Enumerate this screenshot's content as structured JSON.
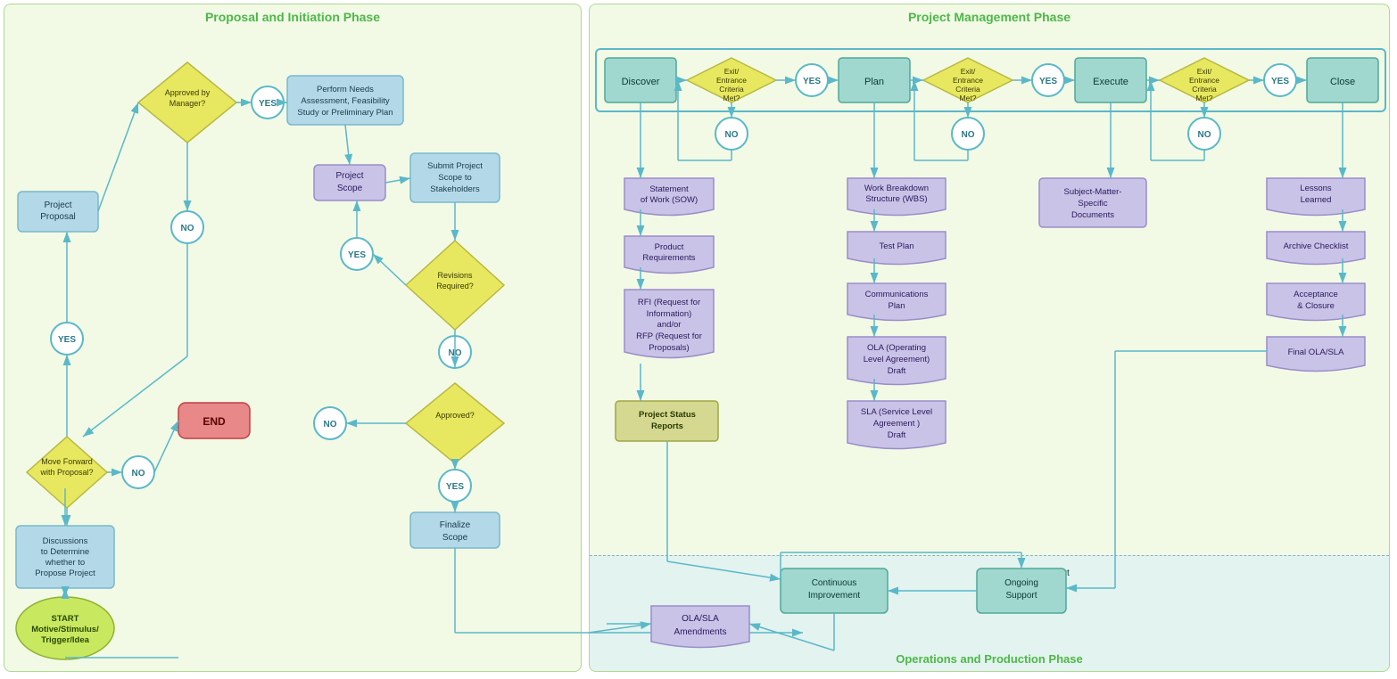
{
  "diagram": {
    "left_title": "Proposal and Initiation Phase",
    "right_title": "Project Management Phase",
    "ops_title": "Operations and Production Phase",
    "nodes": {
      "left": {
        "project_proposal": "Project Proposal",
        "discussions": "Discussions\nto Determine\nwhether to\nPropose Project",
        "start": "START\nMotive/Stimulus/\nTrigger/Idea",
        "move_forward": "Move Forward\nwith Proposal?",
        "approved_manager": "Approved by\nManager?",
        "perform_needs": "Perform Needs\nAssessment, Feasibility\nStudy or Preliminary Plan",
        "project_scope": "Project\nScope",
        "submit_project": "Submit Project\nScope to\nStakeholders",
        "revisions_required": "Revisions\nRequired?",
        "approved": "Approved?",
        "finalize_scope": "Finalize\nScope",
        "end": "END",
        "yes1": "YES",
        "no1": "NO",
        "yes2": "YES",
        "no2": "NO",
        "no3": "NO",
        "yes3": "YES",
        "no4": "NO",
        "yes4": "YES"
      },
      "right": {
        "discover": "Discover",
        "plan": "Plan",
        "execute": "Execute",
        "close": "Close",
        "exit1": "Exit/\nEntrance\nCriteria\nMet?",
        "exit2": "Exit/\nEntrance\nCriteria\nMet?",
        "exit3": "Exit/\nEntrance\nCriteria\nMet?",
        "yes_d": "YES",
        "no_d": "NO",
        "yes_p": "YES",
        "no_p": "NO",
        "yes_e": "YES",
        "no_e": "NO",
        "sow": "Statement\nof Work (SOW)",
        "product_req": "Product\nRequirements",
        "rfi": "RFI (Request for\nInformation)\nand/or\nRFP (Request for\nProposals)",
        "project_status": "Project Status\nReports",
        "wbs": "Work Breakdown\nStructure (WBS)",
        "test_plan": "Test Plan",
        "comms_plan": "Communications\nPlan",
        "ola_draft": "OLA (Operating\nLevel Agreement)\nDraft",
        "sla_draft": "SLA (Service Level\nAgreement )\nDraft",
        "subject_matter": "Subject-Matter-\nSpecific\nDocuments",
        "lessons_learned": "Lessons\nLearned",
        "archive_checklist": "Archive\nChecklist",
        "acceptance": "Acceptance\n& Closure",
        "final_ola": "Final OLA/SLA",
        "continuous_improvement": "Continuous\nImprovement",
        "ongoing_support": "Ongoing\nSupport",
        "ola_amendments": "OLA/SLA\nAmendments"
      }
    }
  }
}
